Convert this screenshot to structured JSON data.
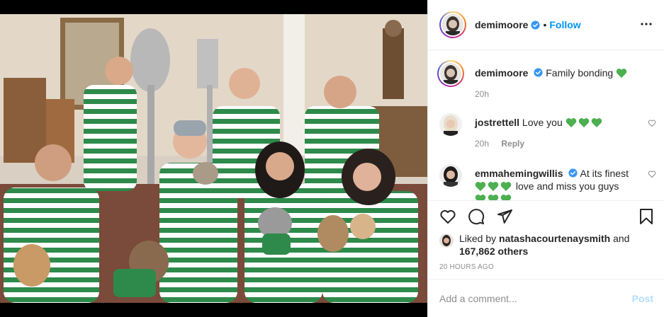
{
  "post": {
    "photo_alt": "",
    "header": {
      "username": "demimoore",
      "separator": "•",
      "follow_label": "Follow",
      "more_icon": "more-horizontal-icon",
      "verified_color": "#3897f0"
    },
    "comments": [
      {
        "username": "demimoore",
        "verified": true,
        "text": "Family bonding",
        "emoji_count": 1,
        "time": "20h",
        "reply_label": ""
      },
      {
        "username": "jostrettell",
        "verified": false,
        "text": "Love you",
        "emoji_count": 3,
        "time": "20h",
        "reply_label": "Reply"
      },
      {
        "username": "emmahemingwillis",
        "verified": true,
        "text_line1": "At its finest",
        "text_line2": "love and miss you guys",
        "emoji_count": 3
      }
    ],
    "actions": {
      "like_icon": "heart-icon",
      "comment_icon": "comment-icon",
      "share_icon": "share-icon",
      "save_icon": "bookmark-icon"
    },
    "likes": {
      "prefix": "Liked by",
      "liker": "natashacourtenaysmith",
      "and": "and",
      "count": "167,862 others"
    },
    "timestamp": "20 HOURS AGO",
    "comment_input": {
      "placeholder": "Add a comment...",
      "post_label": "Post"
    },
    "colors": {
      "accent": "#0095f6",
      "post_disabled": "#b2dffc",
      "heart_green": "#4caf50",
      "text_primary": "#262626",
      "text_secondary": "#8e8e8e"
    }
  }
}
